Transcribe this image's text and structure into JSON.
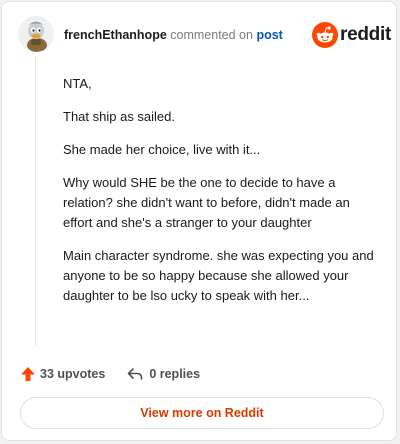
{
  "header": {
    "username": "frenchEthanhope",
    "commented_on": "commented on",
    "post_link": "post",
    "brand_text": "reddit"
  },
  "colors": {
    "brand_orange": "#ff4500",
    "link_blue": "#0a56b0",
    "view_more_text": "#d93a00"
  },
  "comment": {
    "paragraphs": [
      "NTA,",
      "That ship as sailed.",
      "She made her choice, live with it...",
      "Why would SHE be the one to decide to have a relation? she didn't want to before, didn't made an effort and she's a stranger to your daughter",
      "Main character syndrome. she was expecting you and anyone to be so happy because she allowed your daughter to be lso ucky to speak with her..."
    ]
  },
  "actions": {
    "upvotes": "33 upvotes",
    "replies": "0 replies"
  },
  "footer": {
    "view_more": "View more on Reddit"
  },
  "icons": {
    "avatar": "duck-avatar",
    "brand": "reddit-snoo-icon",
    "upvote": "upvote-arrow-icon",
    "reply": "reply-arrow-icon"
  }
}
